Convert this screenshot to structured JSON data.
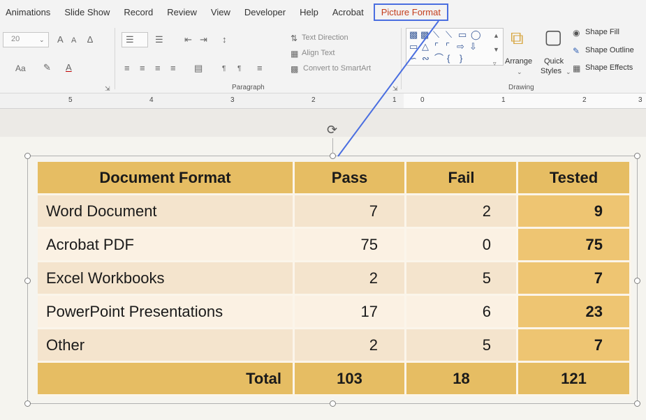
{
  "ribbon_tabs": [
    "Animations",
    "Slide Show",
    "Record",
    "Review",
    "View",
    "Developer",
    "Help",
    "Acrobat",
    "Picture Format"
  ],
  "font": {
    "size": "20",
    "grow_icon": "A",
    "shrink_icon": "A",
    "case_label": "Aa"
  },
  "paragraph": {
    "text_direction": "Text Direction",
    "align_text": "Align Text",
    "convert_smartart": "Convert to SmartArt",
    "group_label": "Paragraph"
  },
  "drawing": {
    "arrange": "Arrange",
    "quick_styles_1": "Quick",
    "quick_styles_2": "Styles",
    "shape_fill": "Shape Fill",
    "shape_outline": "Shape Outline",
    "shape_effects": "Shape Effects",
    "group_label": "Drawing"
  },
  "ruler": {
    "left_numbers": [
      "5",
      "4",
      "3",
      "2",
      "1"
    ],
    "center": "0",
    "right_numbers": [
      "1",
      "2",
      "3"
    ]
  },
  "table": {
    "headers": [
      "Document Format",
      "Pass",
      "Fail",
      "Tested"
    ],
    "rows": [
      {
        "label": "Word Document",
        "pass": "7",
        "fail": "2",
        "tested": "9"
      },
      {
        "label": "Acrobat PDF",
        "pass": "75",
        "fail": "0",
        "tested": "75"
      },
      {
        "label": "Excel Workbooks",
        "pass": "2",
        "fail": "5",
        "tested": "7"
      },
      {
        "label": "PowerPoint Presentations",
        "pass": "17",
        "fail": "6",
        "tested": "23"
      },
      {
        "label": "Other",
        "pass": "2",
        "fail": "5",
        "tested": "7"
      }
    ],
    "total": {
      "label": "Total",
      "pass": "103",
      "fail": "18",
      "tested": "121"
    }
  },
  "colors": {
    "header_gold": "#e6bd63",
    "accent_tab": "#c43e1c",
    "highlight_box": "#4a6ee0"
  }
}
